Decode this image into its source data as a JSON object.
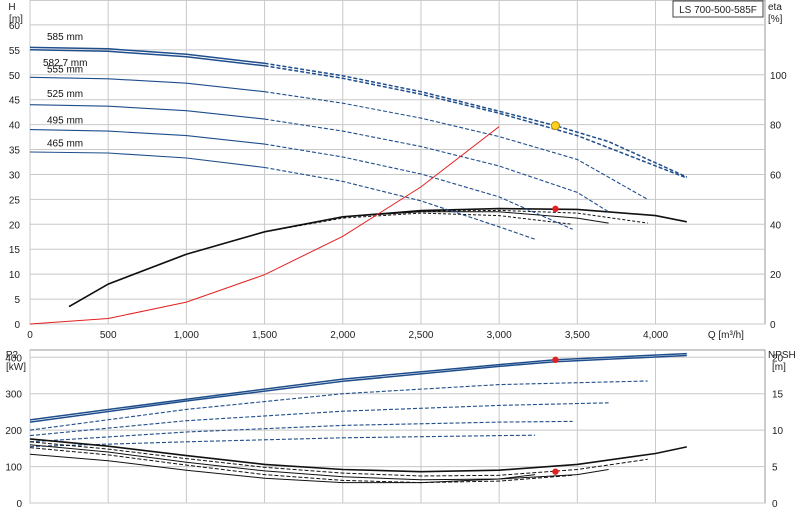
{
  "title": "LS 700-500-585F",
  "chart_data": [
    {
      "type": "line",
      "name": "head-efficiency",
      "xlabel": "Q [m³/h]",
      "xlim": [
        0,
        4700
      ],
      "xticks": [
        0,
        500,
        1000,
        1500,
        2000,
        2500,
        3000,
        3500,
        4000
      ],
      "xtick_labels": [
        "0",
        "500",
        "1,000",
        "1,500",
        "2,000",
        "2,500",
        "3,000",
        "3,500",
        "4,000"
      ],
      "ylabel_left": "H",
      "ylabel_left_unit": "[m]",
      "ylim_left": [
        0,
        65
      ],
      "yticks_left": [
        0,
        5,
        10,
        15,
        20,
        25,
        30,
        35,
        40,
        45,
        50,
        55,
        60
      ],
      "ylabel_right": "eta",
      "ylabel_right_unit": "[%]",
      "ylim_right": [
        0,
        130
      ],
      "yticks_right": [
        0,
        20,
        40,
        60,
        80,
        100
      ],
      "grid": true,
      "head_curves": [
        {
          "name": "585 mm",
          "x": [
            0,
            500,
            1000,
            1500,
            2000,
            2500,
            3000,
            3360,
            3700,
            4200
          ],
          "y": [
            55.5,
            55.2,
            54.1,
            52.3,
            49.8,
            46.6,
            42.7,
            39.8,
            36.6,
            29.5
          ]
        },
        {
          "name": "582.7 mm",
          "x": [
            0,
            500,
            1000,
            1500,
            2000,
            2500,
            3000,
            3500,
            4200
          ],
          "y": [
            55.0,
            54.7,
            53.6,
            51.8,
            49.3,
            46.1,
            42.3,
            37.8,
            29.3
          ]
        },
        {
          "name": "555 mm",
          "x": [
            0,
            500,
            1000,
            1500,
            2000,
            2500,
            3000,
            3500,
            3950
          ],
          "y": [
            49.5,
            49.2,
            48.3,
            46.6,
            44.3,
            41.3,
            37.6,
            33.0,
            25.0
          ]
        },
        {
          "name": "525 mm",
          "x": [
            0,
            500,
            1000,
            1500,
            2000,
            2500,
            3000,
            3500,
            3700
          ],
          "y": [
            44.0,
            43.7,
            42.8,
            41.1,
            38.7,
            35.6,
            31.7,
            26.4,
            22.5
          ]
        },
        {
          "name": "495 mm",
          "x": [
            0,
            500,
            1000,
            1500,
            2000,
            2500,
            3000,
            3470
          ],
          "y": [
            39.0,
            38.7,
            37.8,
            36.1,
            33.5,
            30.1,
            25.5,
            19.0
          ]
        },
        {
          "name": "465 mm",
          "x": [
            0,
            500,
            1000,
            1500,
            2000,
            2500,
            3000,
            3230
          ],
          "y": [
            34.5,
            34.3,
            33.3,
            31.4,
            28.6,
            24.7,
            19.5,
            17.0
          ]
        }
      ],
      "efficiency_curves": [
        {
          "x": [
            250,
            500,
            1000,
            1500,
            2000,
            2500,
            3000,
            3500,
            4000,
            4200
          ],
          "y": [
            7,
            16,
            28,
            37,
            43,
            45.5,
            46.3,
            46.0,
            43.5,
            41
          ]
        },
        {
          "x": [
            250,
            500,
            1000,
            1500,
            2000,
            2500,
            3000,
            3500,
            3950
          ],
          "y": [
            7,
            16,
            28,
            37,
            43,
            45.3,
            45.6,
            44.5,
            40.5
          ]
        },
        {
          "x": [
            250,
            500,
            1000,
            1500,
            2000,
            2500,
            3000,
            3500,
            3700
          ],
          "y": [
            7,
            16,
            28,
            37,
            43,
            45.0,
            45.0,
            42.5,
            40.5
          ]
        },
        {
          "x": [
            250,
            500,
            1000,
            1500,
            2000,
            2500,
            3000,
            3470
          ],
          "y": [
            7,
            16,
            28,
            37,
            42.5,
            44.5,
            43.5,
            40.0
          ]
        }
      ],
      "system_curve": {
        "x": [
          0,
          500,
          1000,
          1500,
          2000,
          2500,
          3000,
          3360
        ],
        "y": [
          0,
          1.1,
          4.4,
          9.9,
          17.6,
          27.5,
          39.6,
          39.8
        ]
      },
      "duty_point_head": {
        "x": 3360,
        "y": 39.8
      },
      "duty_point_eta": {
        "x": 3360,
        "y": 46.2
      }
    },
    {
      "type": "line",
      "name": "power-npsh",
      "xlim": [
        0,
        4700
      ],
      "ylabel_left": "P2",
      "ylabel_left_unit": "[kW]",
      "ylim_left": [
        0,
        420
      ],
      "yticks_left": [
        0,
        100,
        200,
        300,
        400
      ],
      "ylabel_right": "NPSH",
      "ylabel_right_unit": "[m]",
      "ylim_right": [
        0,
        21
      ],
      "yticks_right": [
        0,
        5,
        10,
        15,
        20
      ],
      "grid": true,
      "power_curves": [
        {
          "x": [
            0,
            1000,
            2000,
            3000,
            3360,
            4200
          ],
          "y": [
            228,
            285,
            340,
            380,
            393,
            410
          ]
        },
        {
          "x": [
            0,
            1000,
            2000,
            3000,
            3360,
            4200
          ],
          "y": [
            222,
            280,
            334,
            375,
            388,
            405
          ]
        },
        {
          "x": [
            0,
            1000,
            2000,
            3000,
            3950
          ],
          "y": [
            200,
            257,
            300,
            325,
            335
          ]
        },
        {
          "x": [
            0,
            1000,
            2000,
            3000,
            3700
          ],
          "y": [
            185,
            226,
            252,
            268,
            275
          ]
        },
        {
          "x": [
            0,
            1000,
            2000,
            3000,
            3470
          ],
          "y": [
            168,
            195,
            213,
            222,
            224
          ]
        },
        {
          "x": [
            0,
            1000,
            2000,
            3000,
            3230
          ],
          "y": [
            155,
            168,
            179,
            185,
            186
          ]
        }
      ],
      "npsh_curves": [
        {
          "x": [
            0,
            500,
            1000,
            1500,
            2000,
            2500,
            3000,
            3500,
            4000,
            4200
          ],
          "y": [
            8.8,
            7.8,
            6.5,
            5.3,
            4.6,
            4.3,
            4.5,
            5.3,
            6.8,
            7.7
          ]
        },
        {
          "x": [
            0,
            500,
            1000,
            1500,
            2000,
            2500,
            3000,
            3500,
            3950
          ],
          "y": [
            8.4,
            7.4,
            6.1,
            4.9,
            4.1,
            3.7,
            3.8,
            4.6,
            6.0
          ]
        },
        {
          "x": [
            0,
            500,
            1000,
            1500,
            2000,
            2500,
            3000,
            3500,
            3700
          ],
          "y": [
            8.0,
            7.0,
            5.6,
            4.4,
            3.6,
            3.2,
            3.3,
            3.9,
            4.6
          ]
        },
        {
          "x": [
            0,
            500,
            1000,
            1500,
            2000,
            2500,
            3000,
            3470
          ],
          "y": [
            7.6,
            6.6,
            5.2,
            3.9,
            3.1,
            2.8,
            3.0,
            3.8
          ]
        },
        {
          "x": [
            0,
            500,
            1000,
            1500,
            2000,
            2500,
            3000,
            3230
          ],
          "y": [
            6.7,
            5.8,
            4.5,
            3.4,
            2.8,
            2.8,
            3.3,
            3.9
          ]
        }
      ],
      "duty_point_power": {
        "x": 3360,
        "y": 393
      },
      "duty_point_npsh": {
        "x": 3360,
        "y": 4.3
      }
    }
  ]
}
